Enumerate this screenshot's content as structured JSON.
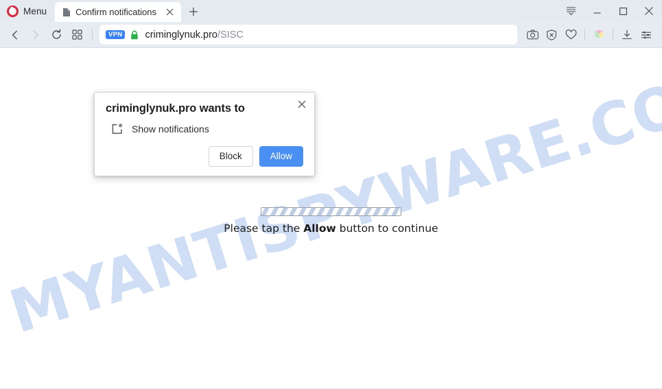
{
  "browser": {
    "menu_label": "Menu",
    "menu_icon": "opera-logo-icon",
    "tab": {
      "title": "Confirm notifications",
      "favicon": "page-document-icon",
      "close_icon": "close-icon"
    },
    "new_tab_icon": "plus-icon",
    "window_controls": {
      "tab_list": "tab-list-chevron-icon",
      "minimize": "minimize-icon",
      "maximize": "maximize-icon",
      "close": "close-icon"
    },
    "nav": {
      "back_icon": "back-chevron-icon",
      "forward_icon": "forward-chevron-icon",
      "reload_icon": "reload-icon",
      "speed_dial_icon": "grid-squares-icon"
    },
    "address_bar": {
      "vpn_badge": "VPN",
      "lock_icon": "padlock-icon",
      "host": "criminglynuk.pro",
      "path": "/SISC"
    },
    "toolbar_icons": [
      {
        "name": "snapshot-camera-icon"
      },
      {
        "name": "ad-blocker-shield-icon"
      },
      {
        "name": "heart-favorite-icon"
      },
      {
        "name": "pinboards-cube-icon"
      },
      {
        "name": "downloads-icon"
      },
      {
        "name": "easy-setup-sliders-icon"
      }
    ]
  },
  "dialog": {
    "title": "criminglynuk.pro wants to",
    "permission_icon": "show-notifications-icon",
    "permission_label": "Show notifications",
    "block_label": "Block",
    "allow_label": "Allow",
    "close_icon": "close-icon"
  },
  "page": {
    "watermark": "MYANTISPYWARE.COM",
    "progress_bar": "striped-progress-bar",
    "instruction_prefix": "Please tap the ",
    "instruction_strong": "Allow",
    "instruction_suffix": " button to continue"
  },
  "colors": {
    "chrome_bg": "#e7ecf2",
    "accent_blue": "#4a90f2",
    "opera_red": "#d7273a",
    "lock_green": "#2bb24c",
    "watermark_blue": "#cddcf5"
  }
}
